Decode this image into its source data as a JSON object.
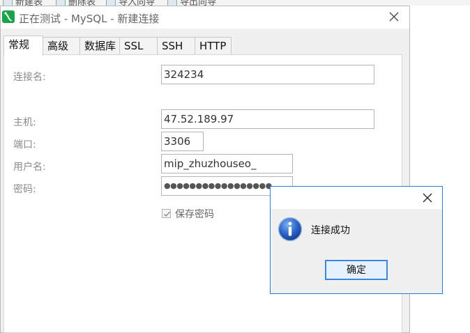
{
  "background_toolbar": {
    "items": [
      "新建表",
      "删除表",
      "导入向导",
      "导出向导"
    ]
  },
  "dialog": {
    "title": "正在测试 - MySQL - 新建连接",
    "tabs": [
      "常规",
      "高级",
      "数据库",
      "SSL",
      "SSH",
      "HTTP"
    ],
    "active_tab": "常规",
    "fields": {
      "connection_name": {
        "label": "连接名:",
        "value": "324234"
      },
      "host": {
        "label": "主机:",
        "value": "47.52.189.97"
      },
      "port": {
        "label": "端口:",
        "value": "3306"
      },
      "username": {
        "label": "用户名:",
        "value": "mip_zhuzhouseo_"
      },
      "password": {
        "label": "密码:",
        "value": "●●●●●●●●●●●●●●●●●"
      }
    },
    "save_password": {
      "label": "保存密码",
      "checked": true
    }
  },
  "message_box": {
    "message": "连接成功",
    "ok_label": "确定",
    "icon": "info-icon"
  },
  "colors": {
    "accent": "#2b79d8",
    "app_icon": "#19a34a"
  }
}
